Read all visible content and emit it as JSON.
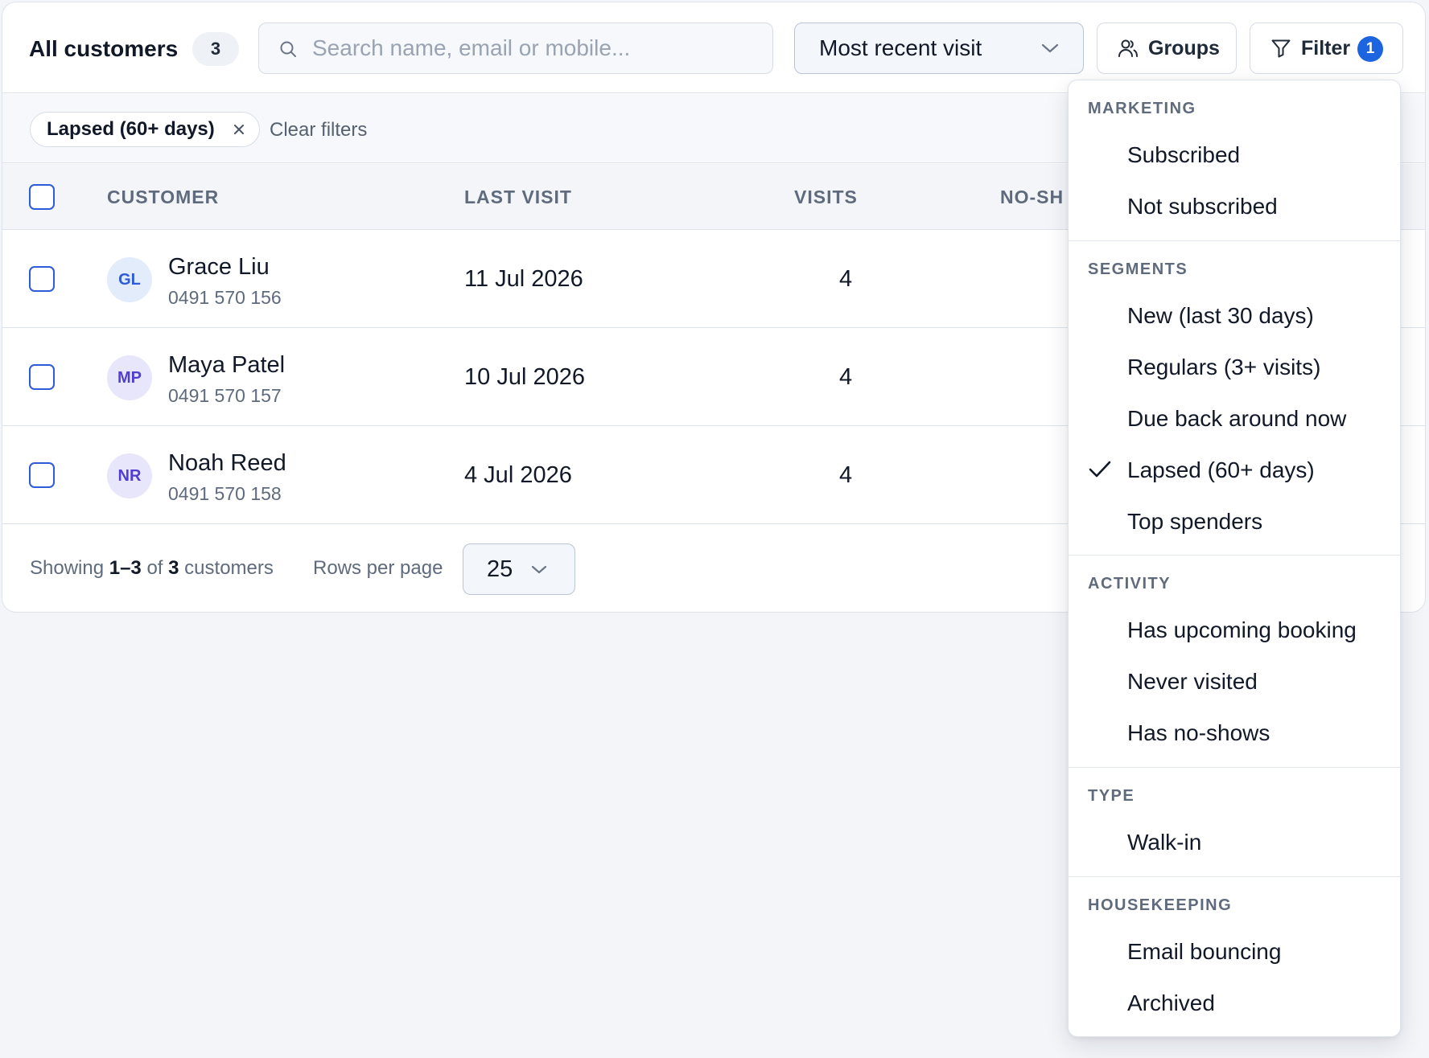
{
  "toolbar": {
    "title": "All customers",
    "count": "3",
    "search_placeholder": "Search name, email or mobile...",
    "sort_value": "Most recent visit",
    "groups_label": "Groups",
    "filter_label": "Filter",
    "filter_count": "1"
  },
  "active_filters": {
    "chip_label": "Lapsed (60+ days)",
    "clear_label": "Clear filters"
  },
  "table": {
    "headers": {
      "customer": "CUSTOMER",
      "last_visit": "LAST VISIT",
      "visits": "VISITS",
      "no_shows": "NO-SH"
    },
    "rows": [
      {
        "initials": "GL",
        "name": "Grace Liu",
        "phone": "0491 570 156",
        "last_visit": "11 Jul 2026",
        "visits": "4",
        "avatar_bg": "#e3ecfb",
        "avatar_fg": "#2e5bd8"
      },
      {
        "initials": "MP",
        "name": "Maya Patel",
        "phone": "0491 570 157",
        "last_visit": "10 Jul 2026",
        "visits": "4",
        "avatar_bg": "#e8e6fb",
        "avatar_fg": "#4f3fd0"
      },
      {
        "initials": "NR",
        "name": "Noah Reed",
        "phone": "0491 570 158",
        "last_visit": "4 Jul 2026",
        "visits": "4",
        "avatar_bg": "#e8e6fb",
        "avatar_fg": "#4f3fd0"
      }
    ]
  },
  "footer": {
    "showing_prefix": "Showing",
    "showing_range": "1–3",
    "showing_of": "of",
    "showing_total": "3",
    "showing_suffix": "customers",
    "rows_per_page_label": "Rows per page",
    "rows_per_page_value": "25"
  },
  "filter_menu": {
    "marketing": {
      "heading": "MARKETING",
      "items": [
        "Subscribed",
        "Not subscribed"
      ]
    },
    "segments": {
      "heading": "SEGMENTS",
      "items": [
        "New (last 30 days)",
        "Regulars (3+ visits)",
        "Due back around now",
        "Lapsed (60+ days)",
        "Top spenders"
      ],
      "checked": "Lapsed (60+ days)"
    },
    "activity": {
      "heading": "ACTIVITY",
      "items": [
        "Has upcoming booking",
        "Never visited",
        "Has no-shows"
      ]
    },
    "type": {
      "heading": "TYPE",
      "items": [
        "Walk-in"
      ]
    },
    "housekeeping": {
      "heading": "HOUSEKEEPING",
      "items": [
        "Email bouncing",
        "Archived"
      ]
    }
  },
  "colors": {
    "accent": "#1d64e0",
    "checkbox_border": "#2e5bd8",
    "muted_text": "#5f6b7d",
    "page_bg": "#f3f5f9"
  }
}
